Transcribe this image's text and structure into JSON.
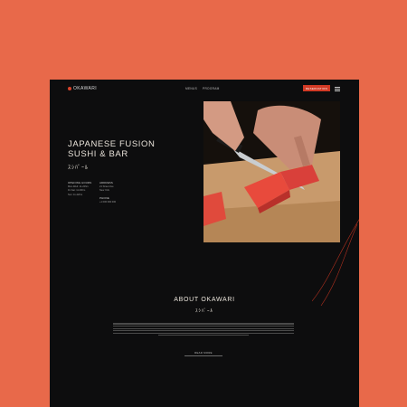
{
  "nav": {
    "logo": "OKAWARI",
    "links": [
      "MENUS",
      "PROGRAM"
    ],
    "reserve_label": "RESERVATION"
  },
  "hero": {
    "title_line1": "JAPANESE FUSION",
    "title_line2": "SUSHI & BAR",
    "jp": "ｽｼﾊﾞｰﾙ",
    "hours": {
      "heading": "OPENING HOURS",
      "lines": [
        "Mon-Wed: 11-22hrs",
        "Fri-Sat: 11-00hrs",
        "Sun: 11-22hrs"
      ]
    },
    "contact": {
      "address_heading": "ADDRESS",
      "address_lines": [
        "21 Street Ave",
        "New York"
      ],
      "phone_heading": "PHONE",
      "phone": "+1 000 000 000"
    }
  },
  "about": {
    "title": "ABOUT OKAWARI",
    "jp": "ｽｼﾊﾞｰﾙ",
    "cta_label": "READ MORE"
  },
  "colors": {
    "page_bg": "#e8694a",
    "site_bg": "#0d0d0e",
    "accent": "#d23a25"
  }
}
